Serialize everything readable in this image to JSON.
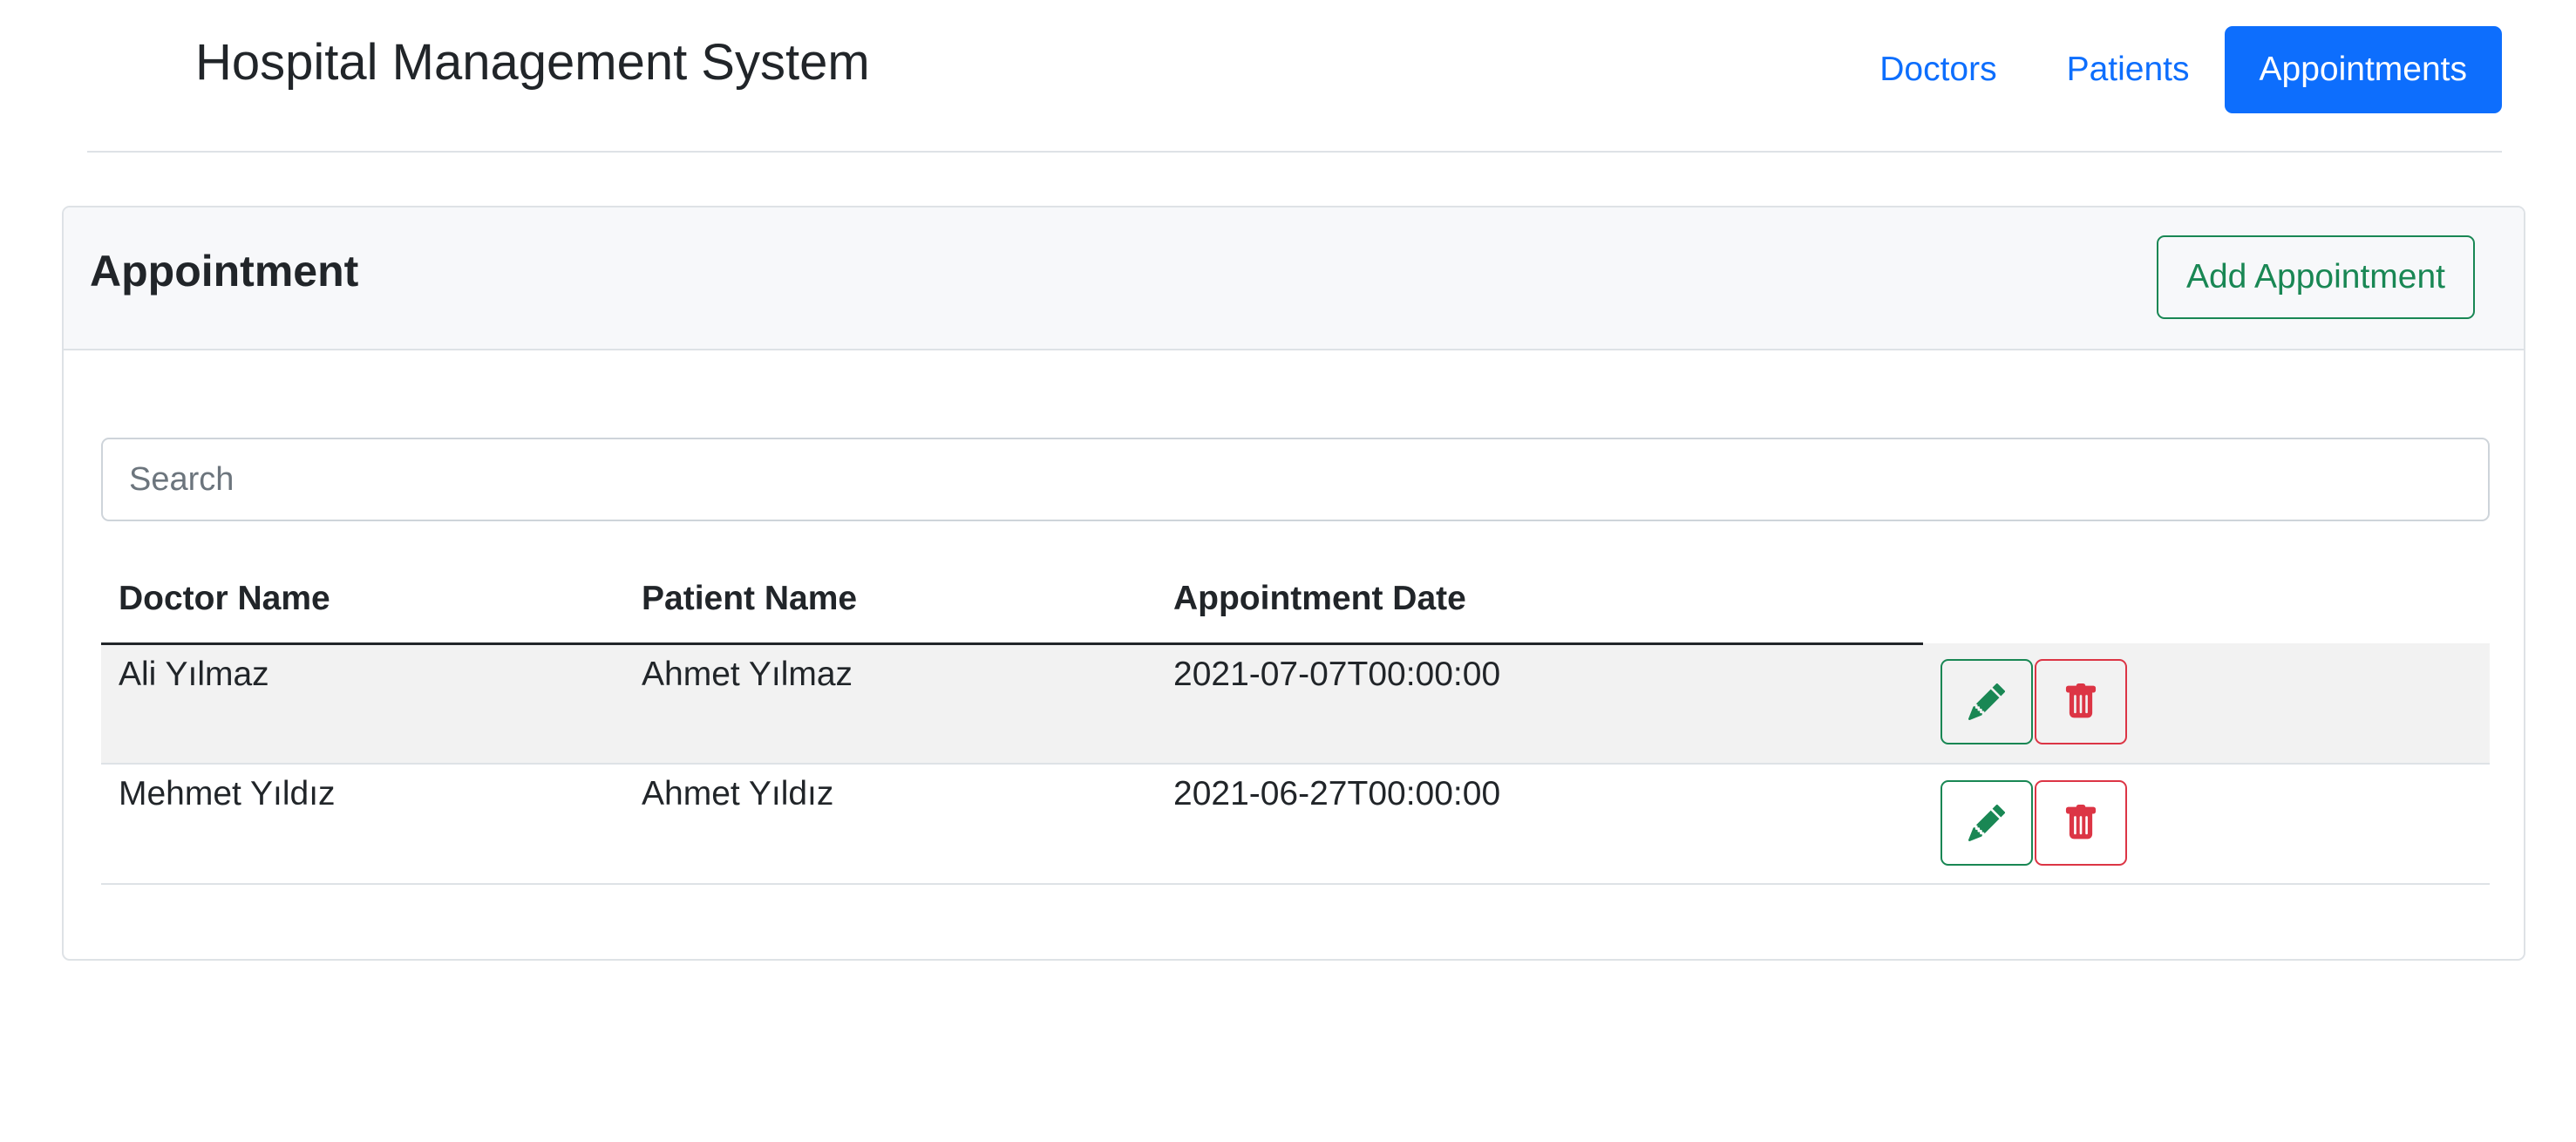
{
  "header": {
    "brand": "Hospital Management System",
    "nav": [
      {
        "label": "Doctors",
        "active": false
      },
      {
        "label": "Patients",
        "active": false
      },
      {
        "label": "Appointments",
        "active": true
      }
    ]
  },
  "card": {
    "title": "Appointment",
    "add_label": "Add Appointment",
    "search": {
      "placeholder": "Search",
      "value": ""
    },
    "table": {
      "columns": [
        "Doctor Name",
        "Patient Name",
        "Appointment Date"
      ],
      "rows": [
        {
          "doctor": "Ali Yılmaz",
          "patient": "Ahmet Yılmaz",
          "date": "2021-07-07T00:00:00",
          "edit_icon": "pencil-icon",
          "delete_icon": "trash-icon"
        },
        {
          "doctor": "Mehmet Yıldız",
          "patient": "Ahmet Yıldız",
          "date": "2021-06-27T00:00:00",
          "edit_icon": "pencil-icon",
          "delete_icon": "trash-icon"
        }
      ]
    }
  },
  "colors": {
    "primary": "#0d6efd",
    "success": "#198754",
    "danger": "#dc3545"
  }
}
